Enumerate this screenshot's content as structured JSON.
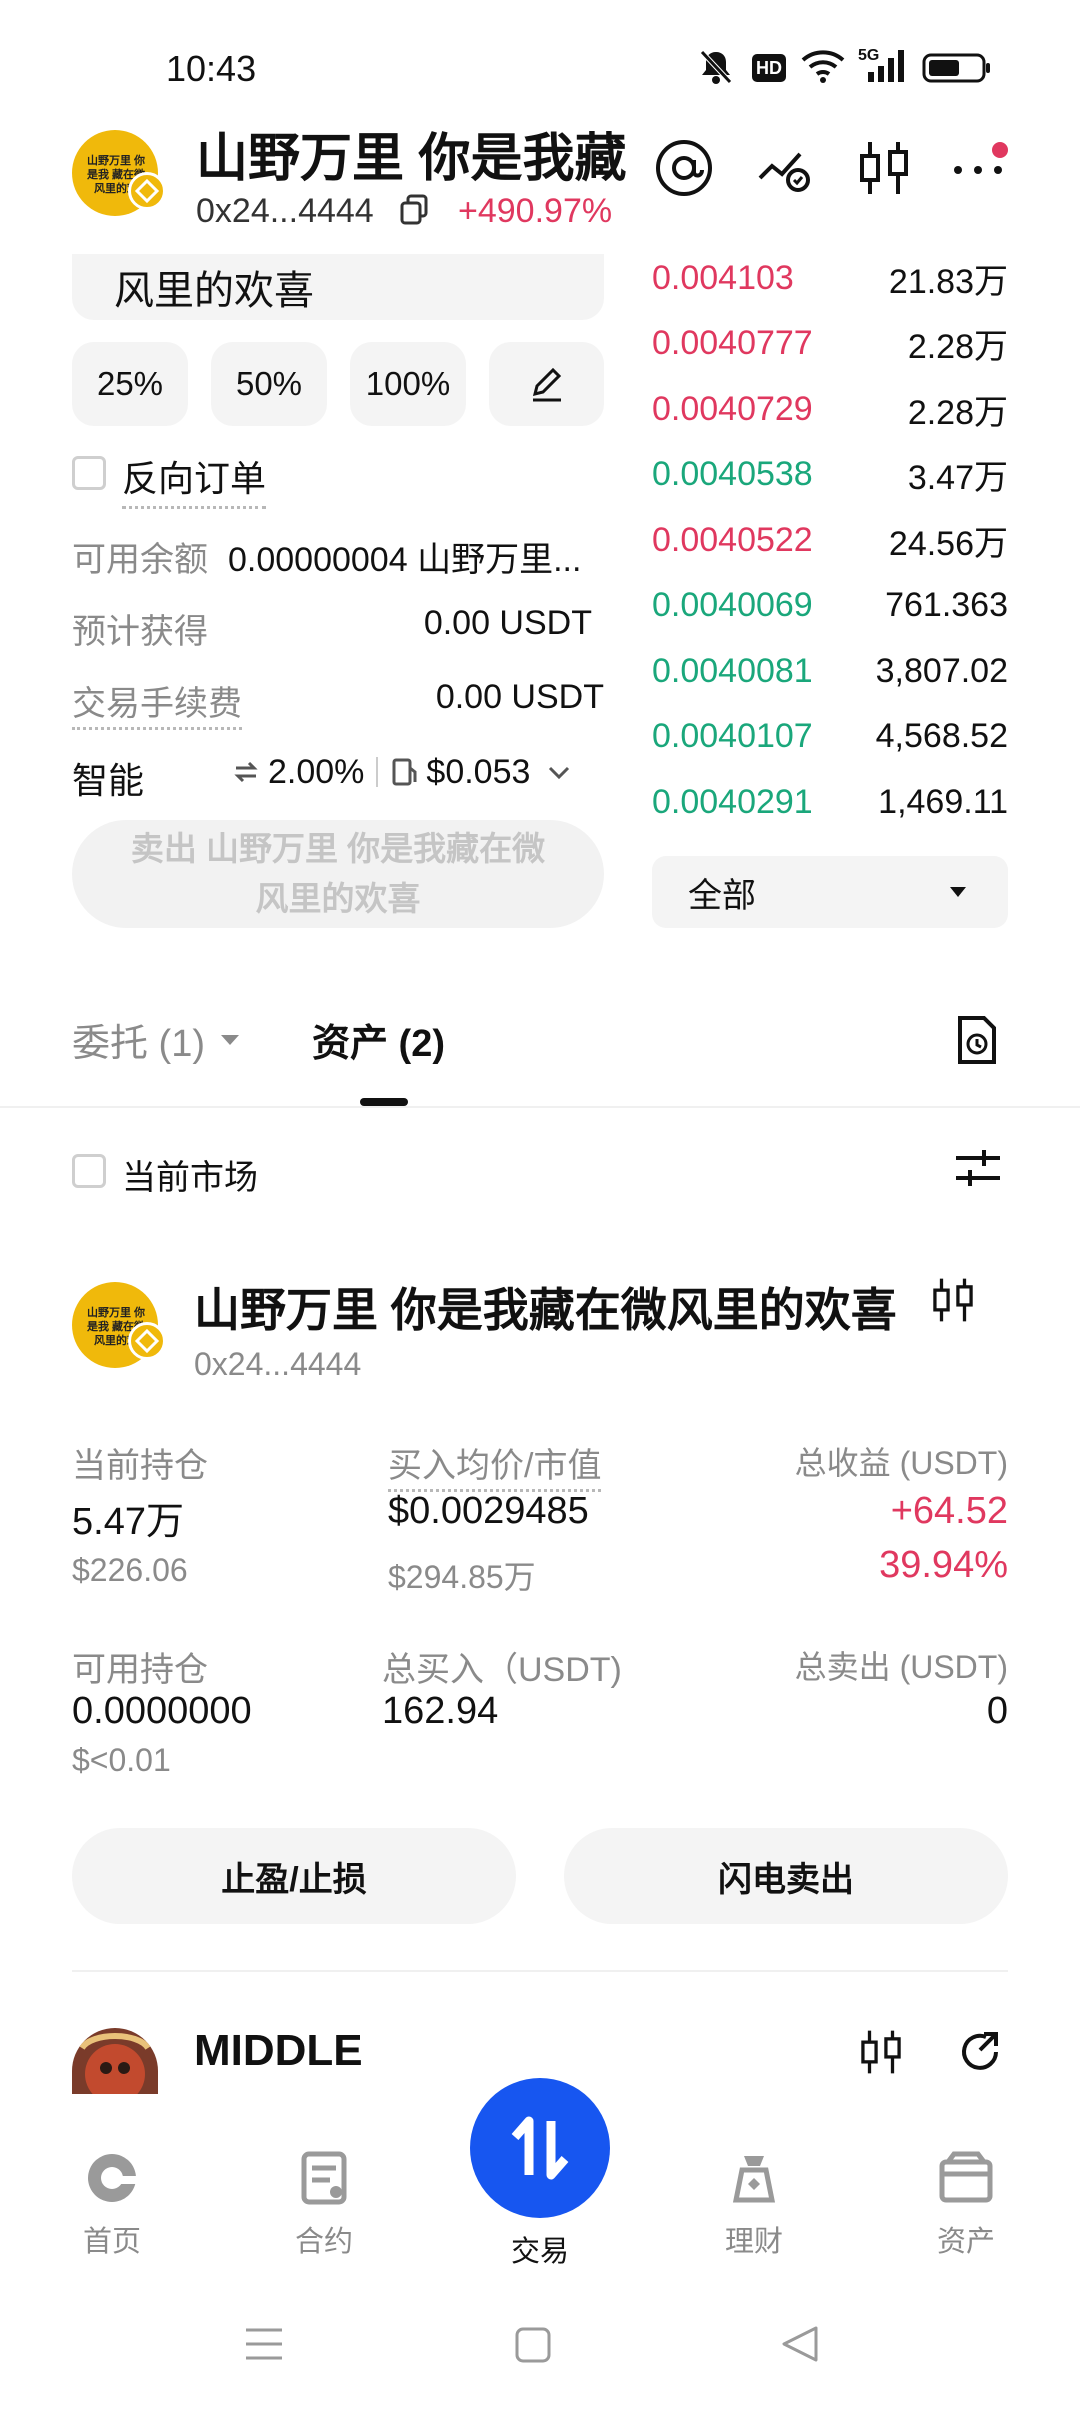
{
  "status_bar": {
    "time": "10:43",
    "icons": [
      "bell-off-icon",
      "hd-icon",
      "wifi-icon",
      "signal-5g-icon",
      "battery-icon"
    ]
  },
  "header": {
    "token_name": "山野万里 你是我藏",
    "address": "0x24...4444",
    "change_pct": "+490.97%",
    "logo_text": "山野万里 你是我 藏在微风里的欢",
    "actions": [
      "at-icon",
      "price-alert-icon",
      "candlestick-icon",
      "more-icon"
    ]
  },
  "order_form": {
    "name_line": "风里的欢喜",
    "pct_buttons": [
      "25%",
      "50%",
      "100%"
    ],
    "reverse_order_label": "反向订单",
    "available_label": "可用余额",
    "available_value": "0.00000004 山野万里...",
    "expected_label": "预计获得",
    "expected_value": "0.00 USDT",
    "fee_label": "交易手续费",
    "fee_value": "0.00 USDT",
    "smart_label": "智能",
    "slippage": "2.00%",
    "gas": "$0.053",
    "sell_button": "卖出 山野万里 你是我藏在微风里的欢喜"
  },
  "orderbook": {
    "rows": [
      {
        "price": "0.004103",
        "amount": "21.83万",
        "side": "red"
      },
      {
        "price": "0.0040777",
        "amount": "2.28万",
        "side": "red"
      },
      {
        "price": "0.0040729",
        "amount": "2.28万",
        "side": "red"
      },
      {
        "price": "0.0040538",
        "amount": "3.47万",
        "side": "green"
      },
      {
        "price": "0.0040522",
        "amount": "24.56万",
        "side": "red"
      },
      {
        "price": "0.0040069",
        "amount": "761.363",
        "side": "green"
      },
      {
        "price": "0.0040081",
        "amount": "3,807.02",
        "side": "green"
      },
      {
        "price": "0.0040107",
        "amount": "4,568.52",
        "side": "green"
      },
      {
        "price": "0.0040291",
        "amount": "1,469.11",
        "side": "green"
      }
    ],
    "filter_label": "全部"
  },
  "tabs": {
    "orders": "委托 (1)",
    "assets": "资产 (2)"
  },
  "filter": {
    "current_market": "当前市场"
  },
  "holding1": {
    "name": "山野万里 你是我藏在微风里的欢喜",
    "address": "0x24...4444",
    "logo_text": "山野万里 你是我 藏在微风里的欢",
    "position_label": "当前持仓",
    "position_value": "5.47万",
    "position_usd": "$226.06",
    "avg_label": "买入均价/市值",
    "avg_value": "$0.0029485",
    "mcap_value": "$294.85万",
    "pnl_label": "总收益 (USDT)",
    "pnl_value": "+64.52",
    "pnl_pct": "39.94%",
    "avail_label": "可用持仓",
    "avail_value": "0.0000000",
    "avail_usd": "$<0.01",
    "total_buy_label": "总买入（USDT)",
    "total_buy_value": "162.94",
    "total_sell_label": "总卖出 (USDT)",
    "total_sell_value": "0",
    "tp_sl_button": "止盈/止损",
    "flash_sell_button": "闪电卖出"
  },
  "holding2": {
    "name": "MIDDLE"
  },
  "bottom_nav": {
    "items": [
      {
        "label": "首页",
        "icon": "home-icon"
      },
      {
        "label": "合约",
        "icon": "contract-icon"
      },
      {
        "label": "交易",
        "icon": "trade-icon"
      },
      {
        "label": "理财",
        "icon": "finance-icon"
      },
      {
        "label": "资产",
        "icon": "wallet-icon"
      }
    ]
  },
  "colors": {
    "red": "#e0385f",
    "green": "#1aa77b",
    "accent_blue": "#1756f0",
    "gold": "#f0b90b"
  }
}
